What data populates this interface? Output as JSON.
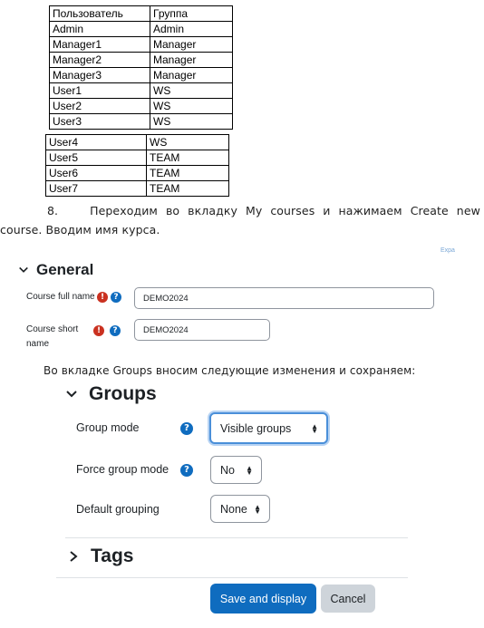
{
  "table1": {
    "headers": [
      "Пользователь",
      "Группа"
    ],
    "rows": [
      [
        "Admin",
        "Admin"
      ],
      [
        "Manager1",
        "Manager"
      ],
      [
        "Manager2",
        "Manager"
      ],
      [
        "Manager3",
        "Manager"
      ],
      [
        "User1",
        "WS"
      ],
      [
        "User2",
        "WS"
      ],
      [
        "User3",
        "WS"
      ]
    ]
  },
  "table2": {
    "rows": [
      [
        "User4",
        "WS"
      ],
      [
        "User5",
        "TEAM"
      ],
      [
        "User6",
        "TEAM"
      ],
      [
        "User7",
        "TEAM"
      ]
    ]
  },
  "step": {
    "number": "8.",
    "line1_words": [
      "Переходим",
      "во",
      "вкладку",
      "My",
      "courses",
      "и",
      "нажимаем",
      "Create",
      "new"
    ],
    "line2": "course. Вводим имя курса."
  },
  "corner_text": "Expa",
  "general": {
    "title": "General",
    "full_name_label": "Course full name",
    "full_name_value": "DEMO2024",
    "short_name_label_1": "Course short",
    "short_name_label_2": "name",
    "short_name_value": "DEMO2024",
    "required_icon": "!",
    "help_icon": "?"
  },
  "groups_instruction": "Во вкладке Groups вносим следующие изменения и сохраняем:",
  "groups": {
    "title": "Groups",
    "group_mode_label": "Group mode",
    "group_mode_value": "Visible groups",
    "force_label": "Force group mode",
    "force_value": "No",
    "default_grouping_label": "Default grouping",
    "default_grouping_value": "None",
    "help_icon": "?"
  },
  "tags": {
    "title": "Tags"
  },
  "buttons": {
    "save": "Save and display",
    "cancel": "Cancel"
  },
  "colors": {
    "primary": "#0f6cbf",
    "required": "#ca3120",
    "secondary_button": "#ced4da",
    "focus_ring": "#4a8fd9"
  },
  "icons": {
    "expanded": "chevron-down-icon",
    "collapsed": "chevron-right-icon",
    "select": "up-down-arrows-icon"
  }
}
